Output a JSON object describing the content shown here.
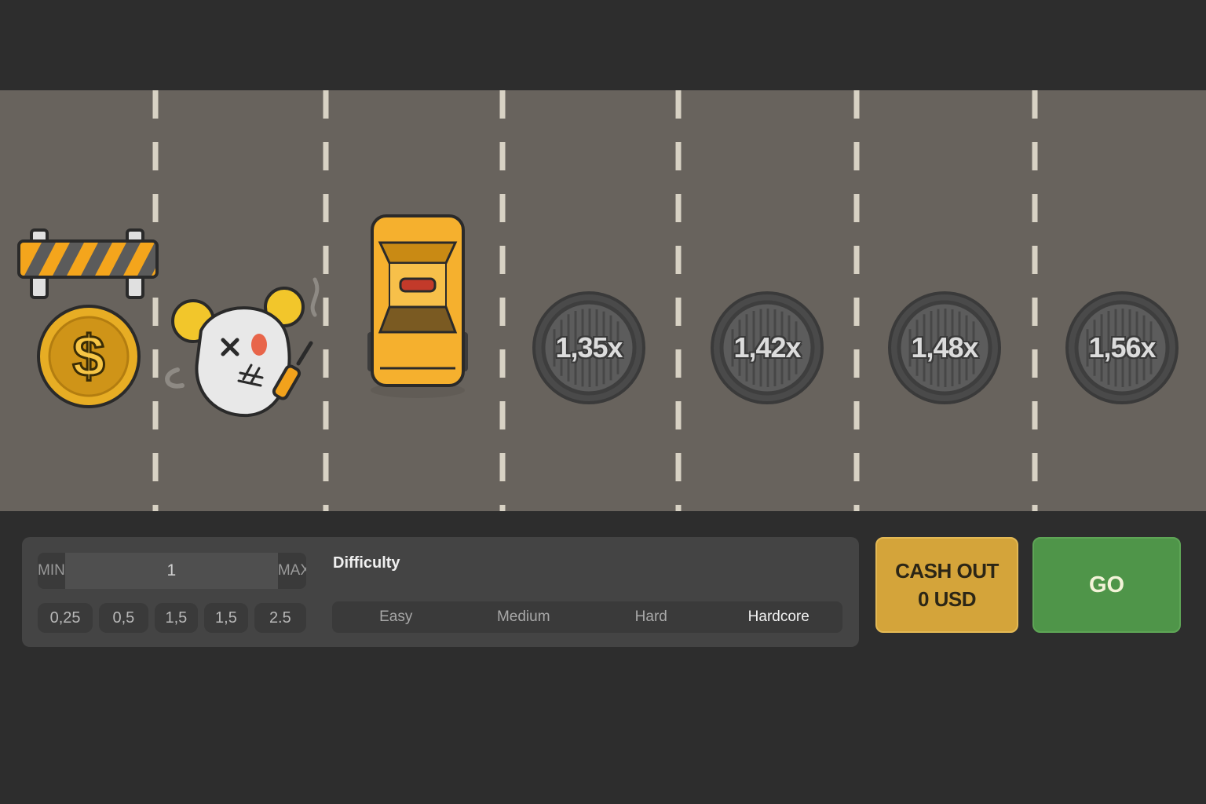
{
  "game": {
    "lanes": [
      {
        "type": "start",
        "icons": [
          "barrier-icon",
          "coin-icon"
        ]
      },
      {
        "type": "player",
        "icons": [
          "chicken-icon"
        ]
      },
      {
        "type": "car",
        "icons": [
          "taxi-icon"
        ]
      },
      {
        "type": "manhole",
        "multiplier": "1,35x"
      },
      {
        "type": "manhole",
        "multiplier": "1,42x"
      },
      {
        "type": "manhole",
        "multiplier": "1,48x"
      },
      {
        "type": "manhole",
        "multiplier": "1,56x"
      }
    ],
    "colors": {
      "road": "#68635d",
      "lane_mark": "#d8d2c4",
      "taxi": "#f5b02e",
      "coin": "#e7ad24"
    }
  },
  "bet": {
    "min_label": "MIN",
    "max_label": "MAX",
    "amount": "1",
    "chips": [
      "0,25",
      "0,5",
      "1,5",
      "1,5",
      "2.5"
    ]
  },
  "difficulty": {
    "label": "Difficulty",
    "options": [
      "Easy",
      "Medium",
      "Hard",
      "Hardcore"
    ],
    "selected": "Hardcore"
  },
  "actions": {
    "cashout_line1": "CASH OUT",
    "cashout_line2": "0 USD",
    "go": "GO",
    "colors": {
      "cashout": "#d4a43a",
      "go": "#4f9549"
    }
  }
}
